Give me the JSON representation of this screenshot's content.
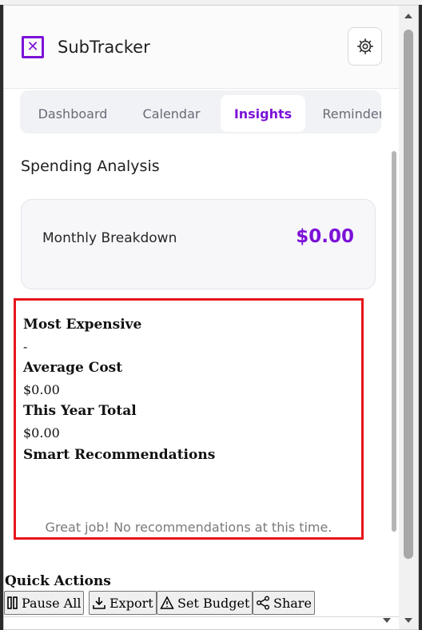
{
  "app": {
    "title": "SubTracker",
    "logo_glyph": "✕",
    "logo_icon": "x-box-icon",
    "settings_icon": "settings-gear-icon",
    "accent_color": "#7c12d8"
  },
  "tabs": [
    {
      "label": "Dashboard",
      "active": false
    },
    {
      "label": "Calendar",
      "active": false
    },
    {
      "label": "Insights",
      "active": true
    },
    {
      "label": "Reminders",
      "active": false
    }
  ],
  "insights": {
    "section_title": "Spending Analysis",
    "monthly": {
      "label": "Monthly Breakdown",
      "value": "$0.00"
    },
    "stats": [
      {
        "label": "Most Expensive",
        "value": "-"
      },
      {
        "label": "Average Cost",
        "value": "$0.00"
      },
      {
        "label": "This Year Total",
        "value": "$0.00"
      }
    ],
    "recommendations": {
      "label": "Smart Recommendations",
      "empty_text": "Great job! No recommendations at this time."
    }
  },
  "quick_actions": {
    "title": "Quick Actions",
    "buttons": [
      {
        "label": "Pause All",
        "icon": "pause-icon"
      },
      {
        "label": "Export",
        "icon": "download-icon"
      },
      {
        "label": "Set Budget",
        "icon": "warning-triangle-icon"
      },
      {
        "label": "Share",
        "icon": "share-icon"
      }
    ]
  }
}
